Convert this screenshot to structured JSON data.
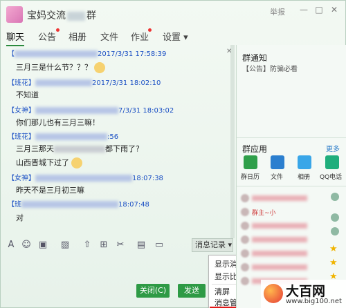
{
  "window": {
    "title_prefix": "宝妈交流",
    "title_suffix": "群",
    "report_label": "举报",
    "minimize_glyph": "—",
    "maximize_glyph": "□",
    "close_glyph": "✕"
  },
  "tabs": [
    {
      "label": "聊天",
      "active": true,
      "dot": false
    },
    {
      "label": "公告",
      "active": false,
      "dot": true
    },
    {
      "label": "相册",
      "active": false,
      "dot": false
    },
    {
      "label": "文件",
      "active": false,
      "dot": false
    },
    {
      "label": "作业",
      "active": false,
      "dot": true
    },
    {
      "label": "设置 ▾",
      "active": false,
      "dot": false
    }
  ],
  "messages": [
    {
      "sender": "【",
      "time": "2017/3/31 17:58:39",
      "text": "三月三是什么节？？？"
    },
    {
      "sender": "【班花】",
      "time": "2017/3/31 18:02:10",
      "text": "不知道"
    },
    {
      "sender": "【女神】",
      "time": "7/3/31 18:03:02",
      "text": "你们那儿也有三月三嘛！"
    },
    {
      "sender": "【班花】",
      "time": ":56",
      "text": "三月三那天",
      "text2": "都下雨了？",
      "text3": "山西晋城下过了"
    },
    {
      "sender": "【女神】",
      "time": "18:07:38",
      "text": "昨天不是三月初三嘛"
    },
    {
      "sender": "【班",
      "time": "18:07:48",
      "text": "对"
    }
  ],
  "toolbar": {
    "history_label": "消息记录 ▾"
  },
  "menu": {
    "items": [
      "显示消息记录",
      "显示比例",
      "清屏",
      "消息管理器"
    ],
    "arrow": "▶"
  },
  "buttons": {
    "close_label": "关闭(C)",
    "send_label": "发送"
  },
  "panel": {
    "notice_title": "群通知",
    "notice_text": "【公告】防骗必看",
    "apps_title": "群应用",
    "more_label": "更多",
    "apps": [
      {
        "label": "群日历",
        "color": "#2f9f4a"
      },
      {
        "label": "文件",
        "color": "#2b7fcf"
      },
      {
        "label": "相册",
        "color": "#39a6e8"
      },
      {
        "label": "QQ电话",
        "color": "#1fae7c"
      }
    ],
    "owner_tag": "群主~小"
  },
  "watermark": {
    "brand": "大百网",
    "url": "www.big100.net"
  }
}
